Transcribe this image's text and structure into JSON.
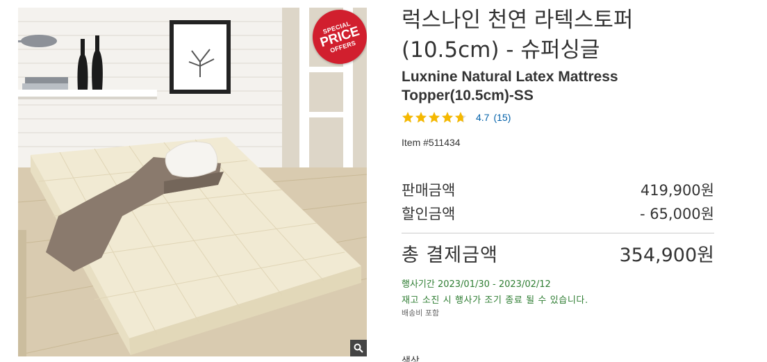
{
  "image": {
    "badge": {
      "line1": "SPECIAL",
      "line2": "PRICE",
      "line3": "OFFERS"
    },
    "zoom_icon": "magnifier-icon"
  },
  "product": {
    "title_ko": "럭스나인 천연 라텍스토퍼 (10.5cm) - 슈퍼싱글",
    "title_en": "Luxnine Natural Latex Mattress Topper(10.5cm)-SS",
    "rating": {
      "value": "4.7",
      "count": "(15)",
      "stars": 4.7,
      "max_stars": 5
    },
    "item_number": "Item #511434"
  },
  "pricing": {
    "sale_label": "판매금액",
    "sale_value": "419,900원",
    "discount_label": "할인금액",
    "discount_value": "- 65,000원",
    "total_label": "총 결제금액",
    "total_value": "354,900원"
  },
  "promotion": {
    "period": "행사기간 2023/01/30 - 2023/02/12",
    "note": "재고 소진 시 행사가 조기 종료 될 수 있습니다.",
    "shipping": "배송비 포함"
  },
  "next_section_label": "색상",
  "colors": {
    "rating_link": "#0060a9",
    "star": "#f5b800",
    "promo_text": "#2e7d32",
    "badge_red": "#d11f2e"
  }
}
